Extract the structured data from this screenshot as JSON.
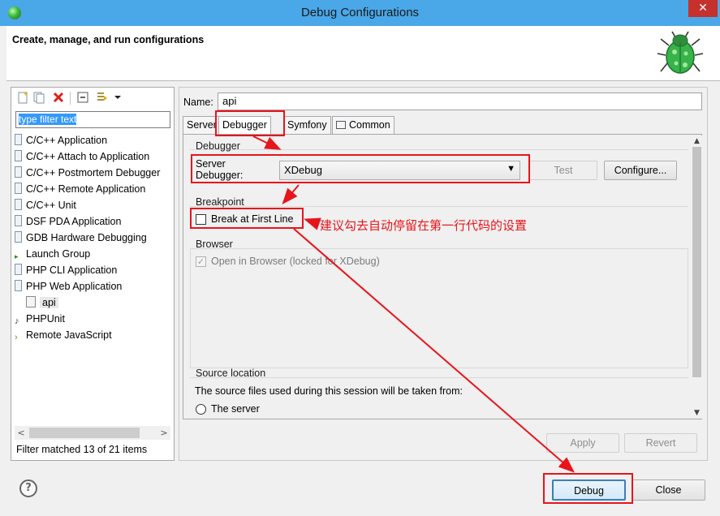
{
  "window": {
    "title": "Debug Configurations",
    "close_glyph": "✕",
    "app_icon": "eclipse-bug-icon"
  },
  "banner": {
    "heading": "Create, manage, and run configurations",
    "icon": "debug-bug-icon"
  },
  "left": {
    "toolbar_icons": [
      "new-config-icon",
      "duplicate-icon",
      "delete-icon",
      "collapse-all-icon",
      "filter-icon",
      "dropdown-icon"
    ],
    "filter_text": "type filter text",
    "tree": [
      {
        "label": "C/C++ Application"
      },
      {
        "label": "C/C++ Attach to Application"
      },
      {
        "label": "C/C++ Postmortem Debugger"
      },
      {
        "label": "C/C++ Remote Application"
      },
      {
        "label": "C/C++ Unit"
      },
      {
        "label": "DSF PDA Application"
      },
      {
        "label": "GDB Hardware Debugging"
      },
      {
        "label": "Launch Group"
      },
      {
        "label": "PHP CLI Application"
      },
      {
        "label": "PHP Web Application"
      },
      {
        "label": "api"
      },
      {
        "label": "PHPUnit"
      },
      {
        "label": "Remote JavaScript"
      }
    ],
    "status": "Filter matched 13 of 21 items"
  },
  "right": {
    "name_label": "Name:",
    "name_value": "api",
    "tabs": [
      {
        "label": "Server"
      },
      {
        "label": "Debugger"
      },
      {
        "label": "Symfony"
      },
      {
        "label": "Common"
      }
    ],
    "debugger_group": "Debugger",
    "server_debugger_label_1": "Server",
    "server_debugger_label_2": "Debugger:",
    "server_debugger_value": "XDebug",
    "test_label": "Test",
    "configure_label": "Configure...",
    "breakpoint_group": "Breakpoint",
    "break_first_line": "Break at First Line",
    "browser_group": "Browser",
    "open_in_browser": "Open in Browser (locked for XDebug)",
    "source_group": "Source location",
    "source_desc": "The source files used during this session will be taken from:",
    "source_option_1": "The server",
    "apply_label": "Apply",
    "revert_label": "Revert"
  },
  "footer": {
    "help_glyph": "?",
    "debug_label": "Debug",
    "close_label": "Close"
  },
  "annotation": {
    "note": "建议勾去自动停留在第一行代码的设置",
    "color": "#e8141b"
  }
}
